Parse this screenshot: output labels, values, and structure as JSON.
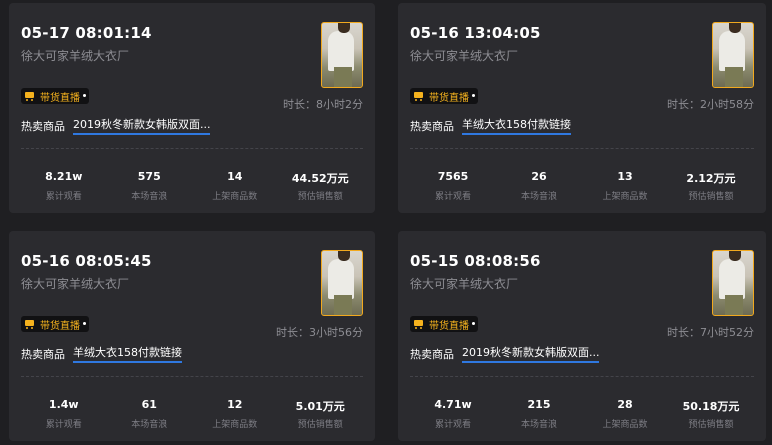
{
  "cards": [
    {
      "date": "05-17 08:01:14",
      "shop": "徐大可家羊绒大衣厂",
      "badge": "带货直播",
      "duration_label": "时长：",
      "duration": "8小时2分",
      "hot_label": "热卖商品",
      "hot_product": "2019秋冬新款女韩版双面...",
      "stats": [
        {
          "value": "8.21w",
          "label": "累计观看"
        },
        {
          "value": "575",
          "label": "本场音浪"
        },
        {
          "value": "14",
          "label": "上架商品数"
        },
        {
          "value": "44.52万元",
          "label": "预估销售额"
        }
      ]
    },
    {
      "date": "05-16 13:04:05",
      "shop": "徐大可家羊绒大衣厂",
      "badge": "带货直播",
      "duration_label": "时长：",
      "duration": "2小时58分",
      "hot_label": "热卖商品",
      "hot_product": "羊绒大衣158付款链接",
      "stats": [
        {
          "value": "7565",
          "label": "累计观看"
        },
        {
          "value": "26",
          "label": "本场音浪"
        },
        {
          "value": "13",
          "label": "上架商品数"
        },
        {
          "value": "2.12万元",
          "label": "预估销售额"
        }
      ]
    },
    {
      "date": "05-16 08:05:45",
      "shop": "徐大可家羊绒大衣厂",
      "badge": "带货直播",
      "duration_label": "时长：",
      "duration": "3小时56分",
      "hot_label": "热卖商品",
      "hot_product": "羊绒大衣158付款链接",
      "stats": [
        {
          "value": "1.4w",
          "label": "累计观看"
        },
        {
          "value": "61",
          "label": "本场音浪"
        },
        {
          "value": "12",
          "label": "上架商品数"
        },
        {
          "value": "5.01万元",
          "label": "预估销售额"
        }
      ]
    },
    {
      "date": "05-15 08:08:56",
      "shop": "徐大可家羊绒大衣厂",
      "badge": "带货直播",
      "duration_label": "时长：",
      "duration": "7小时52分",
      "hot_label": "热卖商品",
      "hot_product": "2019秋冬新款女韩版双面...",
      "stats": [
        {
          "value": "4.71w",
          "label": "累计观看"
        },
        {
          "value": "215",
          "label": "本场音浪"
        },
        {
          "value": "28",
          "label": "上架商品数"
        },
        {
          "value": "50.18万元",
          "label": "预估销售额"
        }
      ]
    }
  ],
  "colors": {
    "background": "#1f1f22",
    "card": "#2b2b2f",
    "accent": "#f5b21e",
    "link_underline": "#2f78e0",
    "muted_text": "#8d8d93"
  },
  "icons": {
    "badge_icon": "shopping-cart-icon",
    "thumbnail": "product-thumbnail"
  }
}
